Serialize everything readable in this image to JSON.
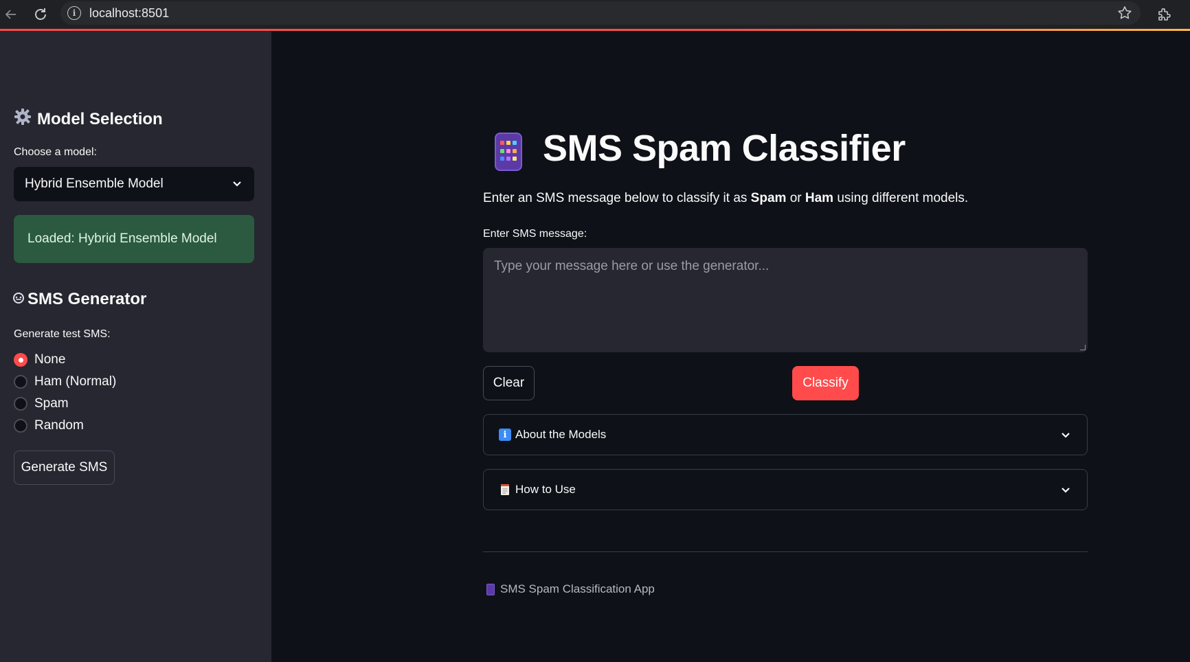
{
  "browser": {
    "url": "localhost:8501",
    "icons": [
      "back-arrow-icon",
      "reload-icon",
      "info-icon",
      "star-icon",
      "extensions-icon"
    ]
  },
  "sidebar": {
    "model_heading": "Model Selection",
    "model_label": "Choose a model:",
    "model_selected": "Hybrid Ensemble Model",
    "loaded_status": "Loaded: Hybrid Ensemble Model",
    "generator_heading": "SMS Generator",
    "generator_label": "Generate test SMS:",
    "radio_options": [
      {
        "label": "None",
        "checked": true
      },
      {
        "label": "Ham (Normal)",
        "checked": false
      },
      {
        "label": "Spam",
        "checked": false
      },
      {
        "label": "Random",
        "checked": false
      }
    ],
    "generate_button": "Generate SMS"
  },
  "main": {
    "title": "SMS Spam Classifier",
    "intro_pre": "Enter an SMS message below to classify it as ",
    "intro_spam": "Spam",
    "intro_or": " or ",
    "intro_ham": "Ham",
    "intro_post": " using different models.",
    "input_label": "Enter SMS message:",
    "input_placeholder": "Type your message here or use the generator...",
    "input_value": "",
    "clear_button": "Clear",
    "classify_button": "Classify",
    "expanders": [
      {
        "label": "About the Models",
        "icon": "info-icon"
      },
      {
        "label": "How to Use",
        "icon": "memo-icon"
      }
    ],
    "footer": "SMS Spam Classification App"
  },
  "colors": {
    "accent": "#ff4b4b",
    "background": "#0e1117",
    "sidebar": "#262730",
    "success": "#2b5a40"
  }
}
